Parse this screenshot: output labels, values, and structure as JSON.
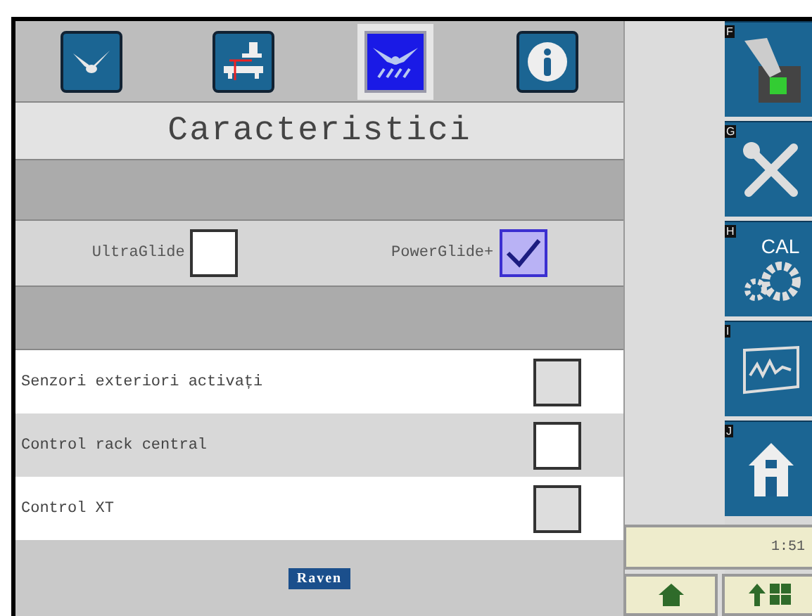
{
  "tabs": [
    {
      "kind": "wing",
      "selected": false
    },
    {
      "kind": "boom",
      "selected": false
    },
    {
      "kind": "glide",
      "selected": true
    },
    {
      "kind": "info",
      "selected": false
    }
  ],
  "title": "Caracteristici",
  "options": [
    {
      "label": "UltraGlide",
      "checked": false
    },
    {
      "label": "PowerGlide+",
      "checked": true
    }
  ],
  "features": [
    {
      "label": "Senzori exteriori activați",
      "checked": false,
      "disabled": true
    },
    {
      "label": "Control rack central",
      "checked": false,
      "disabled": false
    },
    {
      "label": "Control XT",
      "checked": false,
      "disabled": true
    }
  ],
  "logo": "Raven",
  "softkeys": [
    {
      "key": "F",
      "kind": "machine"
    },
    {
      "key": "G",
      "kind": "tools"
    },
    {
      "key": "H",
      "kind": "calibration",
      "label": "CAL"
    },
    {
      "key": "I",
      "kind": "chart"
    },
    {
      "key": "J",
      "kind": "home"
    }
  ],
  "status": "1:51",
  "bottom_buttons": [
    {
      "kind": "home"
    },
    {
      "kind": "up-grid"
    }
  ]
}
